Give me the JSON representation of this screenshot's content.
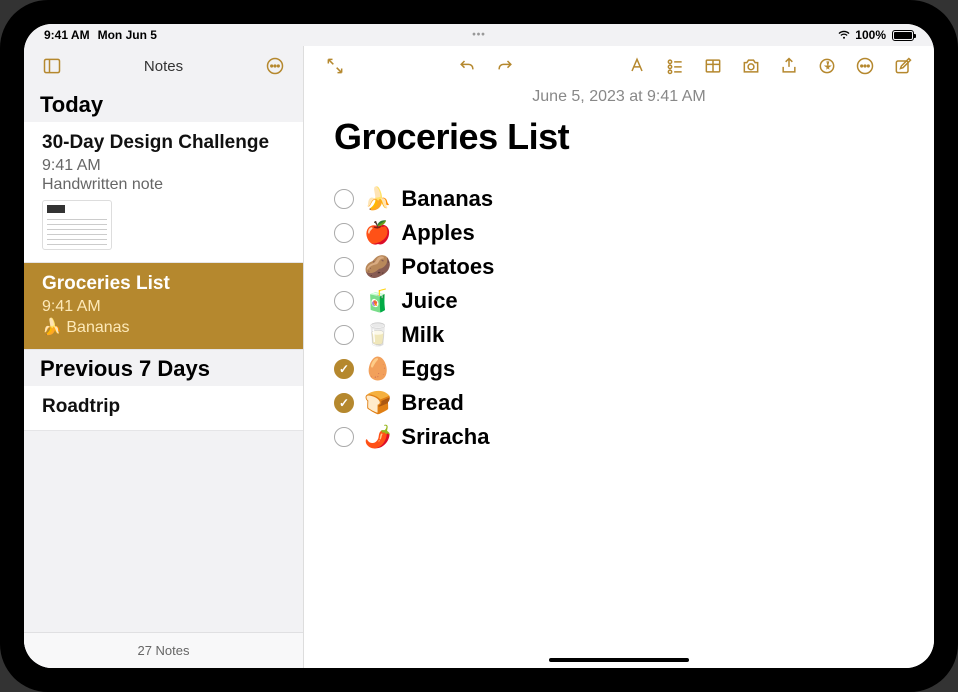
{
  "status": {
    "time": "9:41 AM",
    "date": "Mon Jun 5",
    "battery": "100%"
  },
  "sidebar": {
    "title": "Notes",
    "sections": [
      {
        "header": "Today"
      },
      {
        "header": "Previous 7 Days"
      }
    ],
    "notes": [
      {
        "title": "30-Day Design Challenge",
        "time": "9:41 AM",
        "preview": "Handwritten note",
        "selected": false,
        "hasThumb": true
      },
      {
        "title": "Groceries List",
        "time": "9:41 AM",
        "preview": "🍌 Bananas",
        "selected": true,
        "hasThumb": false
      },
      {
        "title": "Roadtrip",
        "time": "",
        "preview": "",
        "selected": false,
        "hasThumb": false
      }
    ],
    "footer": "27 Notes"
  },
  "note": {
    "date": "June 5, 2023 at 9:41 AM",
    "title": "Groceries List",
    "items": [
      {
        "emoji": "🍌",
        "text": "Bananas",
        "checked": false
      },
      {
        "emoji": "🍎",
        "text": "Apples",
        "checked": false
      },
      {
        "emoji": "🥔",
        "text": "Potatoes",
        "checked": false
      },
      {
        "emoji": "🧃",
        "text": "Juice",
        "checked": false
      },
      {
        "emoji": "🥛",
        "text": "Milk",
        "checked": false
      },
      {
        "emoji": "🥚",
        "text": "Eggs",
        "checked": true
      },
      {
        "emoji": "🍞",
        "text": "Bread",
        "checked": true
      },
      {
        "emoji": "🌶️",
        "text": "Sriracha",
        "checked": false
      }
    ]
  },
  "colors": {
    "accent": "#b5882e"
  }
}
